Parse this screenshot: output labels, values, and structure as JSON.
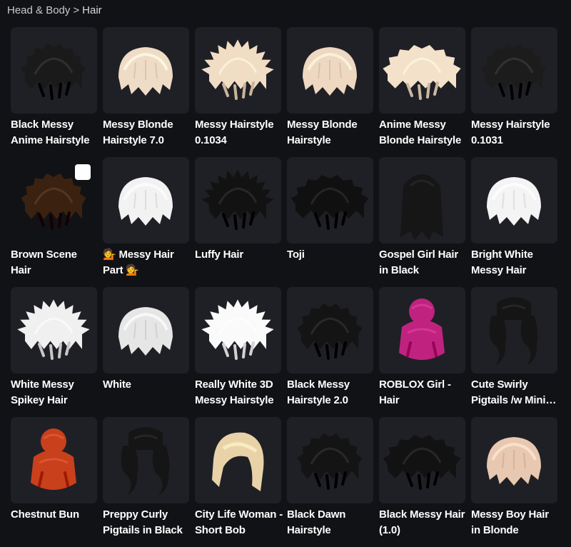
{
  "breadcrumb": {
    "parent": "Head & Body",
    "separator": ">",
    "current": "Hair"
  },
  "items": [
    {
      "name": "Black Messy Anime Hairstyle",
      "color": "#1a1a1a",
      "shape": "messy",
      "selected": false,
      "thumb_bg": true
    },
    {
      "name": "Messy Blonde Hairstyle 7.0",
      "color": "#efdcc6",
      "shape": "bob",
      "selected": false,
      "thumb_bg": true
    },
    {
      "name": "Messy Hairstyle 0.1034",
      "color": "#f1dcc4",
      "shape": "spiky",
      "selected": false,
      "thumb_bg": true
    },
    {
      "name": "Messy Blonde Hairstyle",
      "color": "#eed8c2",
      "shape": "bob",
      "selected": false,
      "thumb_bg": true
    },
    {
      "name": "Anime Messy Blonde Hairstyle",
      "color": "#f3e1ca",
      "shape": "wide",
      "selected": false,
      "thumb_bg": true
    },
    {
      "name": "Messy Hairstyle 0.1031",
      "color": "#1c1c1c",
      "shape": "messy",
      "selected": false,
      "thumb_bg": true
    },
    {
      "name": "Brown Scene Hair",
      "color": "#3b2210",
      "shape": "messy",
      "selected": true,
      "thumb_bg": false
    },
    {
      "name": "💁 Messy Hair Part 💁",
      "color": "#f2f2f2",
      "shape": "bob",
      "selected": false,
      "thumb_bg": true
    },
    {
      "name": "Luffy Hair",
      "color": "#121212",
      "shape": "spiky",
      "selected": false,
      "thumb_bg": true
    },
    {
      "name": "Toji",
      "color": "#101010",
      "shape": "wide",
      "selected": false,
      "thumb_bg": true
    },
    {
      "name": "Gospel Girl Hair in Black",
      "color": "#161616",
      "shape": "long",
      "selected": false,
      "thumb_bg": true
    },
    {
      "name": "Bright White Messy Hair",
      "color": "#f4f4f4",
      "shape": "bob",
      "selected": false,
      "thumb_bg": true
    },
    {
      "name": "White Messy Spikey Hair",
      "color": "#f0f0f0",
      "shape": "spiky",
      "selected": false,
      "thumb_bg": true
    },
    {
      "name": "White",
      "color": "#e6e6e6",
      "shape": "bob",
      "selected": false,
      "thumb_bg": true
    },
    {
      "name": "Really White 3D Messy Hairstyle",
      "color": "#fafafa",
      "shape": "spiky",
      "selected": false,
      "thumb_bg": true
    },
    {
      "name": "Black Messy Hairstyle 2.0",
      "color": "#141414",
      "shape": "messy",
      "selected": false,
      "thumb_bg": true
    },
    {
      "name": "ROBLOX Girl - Hair",
      "color": "#c0237f",
      "shape": "bun",
      "selected": false,
      "thumb_bg": true
    },
    {
      "name": "Cute Swirly Pigtails /w Mini Buns",
      "color": "#151515",
      "shape": "pigtails",
      "selected": false,
      "thumb_bg": true
    },
    {
      "name": "Chestnut Bun",
      "color": "#c8401c",
      "shape": "bun",
      "selected": false,
      "thumb_bg": true
    },
    {
      "name": "Preppy Curly Pigtails in Black",
      "color": "#151515",
      "shape": "pigtails",
      "selected": false,
      "thumb_bg": true
    },
    {
      "name": "City Life Woman - Short Bob",
      "color": "#e9d2a8",
      "shape": "swoop",
      "selected": false,
      "thumb_bg": true
    },
    {
      "name": "Black Dawn Hairstyle",
      "color": "#141414",
      "shape": "messy",
      "selected": false,
      "thumb_bg": true
    },
    {
      "name": "Black Messy Hair (1.0)",
      "color": "#121212",
      "shape": "wide",
      "selected": false,
      "thumb_bg": true
    },
    {
      "name": "Messy Boy Hair in Blonde",
      "color": "#e8c8b0",
      "shape": "bob",
      "selected": false,
      "thumb_bg": true
    }
  ]
}
